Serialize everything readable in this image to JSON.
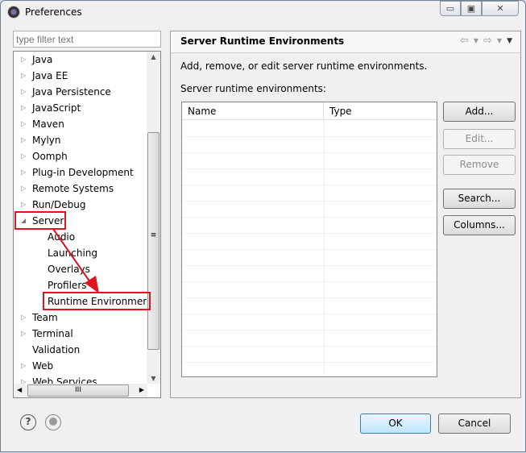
{
  "window": {
    "title": "Preferences",
    "controls": [
      "minimize",
      "maximize",
      "close"
    ]
  },
  "filter": {
    "placeholder": "type filter text"
  },
  "tree": {
    "items": [
      {
        "label": "Java",
        "level": 0,
        "expander": "collapsed"
      },
      {
        "label": "Java EE",
        "level": 0,
        "expander": "collapsed"
      },
      {
        "label": "Java Persistence",
        "level": 0,
        "expander": "collapsed"
      },
      {
        "label": "JavaScript",
        "level": 0,
        "expander": "collapsed"
      },
      {
        "label": "Maven",
        "level": 0,
        "expander": "collapsed"
      },
      {
        "label": "Mylyn",
        "level": 0,
        "expander": "collapsed"
      },
      {
        "label": "Oomph",
        "level": 0,
        "expander": "collapsed"
      },
      {
        "label": "Plug-in Development",
        "level": 0,
        "expander": "collapsed"
      },
      {
        "label": "Remote Systems",
        "level": 0,
        "expander": "collapsed"
      },
      {
        "label": "Run/Debug",
        "level": 0,
        "expander": "collapsed"
      },
      {
        "label": "Server",
        "level": 0,
        "expander": "expanded",
        "highlight": true
      },
      {
        "label": "Audio",
        "level": 1,
        "expander": "none"
      },
      {
        "label": "Launching",
        "level": 1,
        "expander": "none"
      },
      {
        "label": "Overlays",
        "level": 1,
        "expander": "none"
      },
      {
        "label": "Profilers",
        "level": 1,
        "expander": "none"
      },
      {
        "label": "Runtime Environment",
        "level": 1,
        "expander": "none",
        "highlight": true,
        "selected": true
      },
      {
        "label": "Team",
        "level": 0,
        "expander": "collapsed"
      },
      {
        "label": "Terminal",
        "level": 0,
        "expander": "collapsed"
      },
      {
        "label": "Validation",
        "level": 0,
        "expander": "none"
      },
      {
        "label": "Web",
        "level": 0,
        "expander": "collapsed"
      },
      {
        "label": "Web Services",
        "level": 0,
        "expander": "collapsed"
      }
    ]
  },
  "page": {
    "title": "Server Runtime Environments",
    "description": "Add, remove, or edit server runtime environments.",
    "table_label": "Server runtime environments:",
    "columns": [
      "Name",
      "Type"
    ],
    "rows": [],
    "buttons": [
      {
        "label": "Add...",
        "enabled": true
      },
      {
        "label": "Edit...",
        "enabled": false
      },
      {
        "label": "Remove",
        "enabled": false
      },
      {
        "label": "Search...",
        "enabled": true
      },
      {
        "label": "Columns...",
        "enabled": true
      }
    ]
  },
  "footer": {
    "ok": "OK",
    "cancel": "Cancel"
  },
  "colors": {
    "annotation": "#e0141e",
    "selected_bg": "#ffffff"
  }
}
